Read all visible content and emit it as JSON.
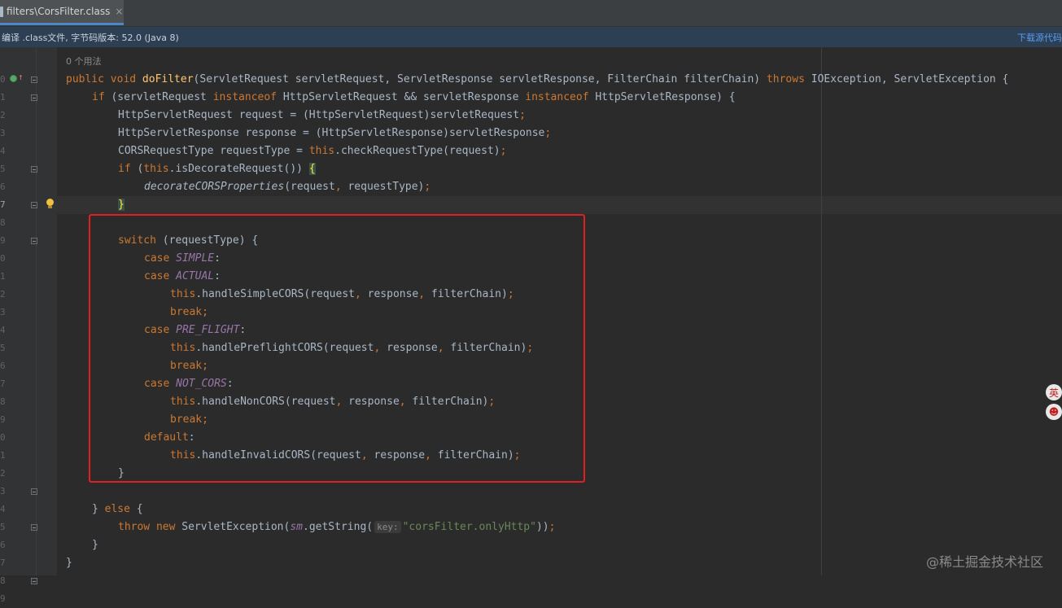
{
  "tab": {
    "label": "filters\\CorsFilter.class",
    "close": "×"
  },
  "infobar": {
    "text": "编译 .class文件, 字节码版本: 52.0 (Java 8)",
    "download_label": "下载源代码"
  },
  "gutter_numbers": [
    "",
    "0",
    "1",
    "2",
    "3",
    "4",
    "5",
    "6",
    "7",
    "8",
    "9",
    "0",
    "1",
    "2",
    "3",
    "4",
    "5",
    "6",
    "7",
    "8",
    "9",
    "0",
    "1",
    "2",
    "3",
    "4",
    "5",
    "6",
    "7",
    "8",
    "9"
  ],
  "code": {
    "usage_hint": "0 个用法",
    "l_sig": {
      "mods": "public void ",
      "name": "doFilter",
      "params": "(ServletRequest servletRequest, ServletResponse servletResponse, FilterChain filterChain) ",
      "throws": "throws",
      "rest": " IOException, ServletException {"
    },
    "l_if": {
      "kw1": "if",
      "t1": " (servletRequest ",
      "kw2": "instanceof",
      "t2": " HttpServletRequest && servletResponse ",
      "kw3": "instanceof",
      "t3": " HttpServletResponse) {"
    },
    "l_req": {
      "t1": "HttpServletRequest request = (HttpServletRequest)servletRequest",
      "semi": ";"
    },
    "l_resp": {
      "t1": "HttpServletResponse response = (HttpServletResponse)servletResponse",
      "semi": ";"
    },
    "l_type": {
      "t1": "CORSRequestType requestType = ",
      "kw": "this",
      "t2": ".checkRequestType(request)",
      "semi": ";"
    },
    "l_ifdec": {
      "kw1": "if",
      "t1": " (",
      "kw2": "this",
      "t2": ".isDecorateRequest()) ",
      "brace": "{"
    },
    "l_decor": {
      "call": "decorateCORSProperties",
      "t1": "(request",
      "comma": ",",
      "t2": " requestType)",
      "semi": ";"
    },
    "l_close1": {
      "brace": "}"
    },
    "l_switch": {
      "kw": "switch",
      "t1": " (requestType) {"
    },
    "l_case1": {
      "kw": "case ",
      "val": "SIMPLE",
      "colon": ":"
    },
    "l_case2": {
      "kw": "case ",
      "val": "ACTUAL",
      "colon": ":"
    },
    "l_simple": {
      "kw": "this",
      "t1": ".handleSimpleCORS(request",
      "c1": ",",
      "t2": " response",
      "c2": ",",
      "t3": " filterChain)",
      "semi": ";"
    },
    "l_break1": {
      "kw": "break",
      "semi": ";"
    },
    "l_case3": {
      "kw": "case ",
      "val": "PRE_FLIGHT",
      "colon": ":"
    },
    "l_preflight": {
      "kw": "this",
      "t1": ".handlePreflightCORS(request",
      "c1": ",",
      "t2": " response",
      "c2": ",",
      "t3": " filterChain)",
      "semi": ";"
    },
    "l_break2": {
      "kw": "break",
      "semi": ";"
    },
    "l_case4": {
      "kw": "case ",
      "val": "NOT_CORS",
      "colon": ":"
    },
    "l_noncors": {
      "kw": "this",
      "t1": ".handleNonCORS(request",
      "c1": ",",
      "t2": " response",
      "c2": ",",
      "t3": " filterChain)",
      "semi": ";"
    },
    "l_break3": {
      "kw": "break",
      "semi": ";"
    },
    "l_default": {
      "kw": "default",
      "colon": ":"
    },
    "l_invalid": {
      "kw": "this",
      "t1": ".handleInvalidCORS(request",
      "c1": ",",
      "t2": " response",
      "c2": ",",
      "t3": " filterChain)",
      "semi": ";"
    },
    "l_close2": {
      "brace": "}"
    },
    "l_else": {
      "t1": "} ",
      "kw": "else",
      "t2": " {"
    },
    "l_throw": {
      "kw1": "throw",
      "sp": " ",
      "kw2": "new",
      "t1": " ServletException(",
      "fld": "sm",
      "t2": ".getString(",
      "hint": "key:",
      "str": "\"corsFilter.onlyHttp\"",
      "t3": "))",
      "semi": ";"
    },
    "l_close3": {
      "brace": "}"
    },
    "l_close4": {
      "brace": "}"
    }
  },
  "side_widgets": {
    "lang": "英",
    "mascot": "☻"
  },
  "watermark": "@稀土掘金技术社区",
  "colors": {
    "keyword": "#cc7832",
    "function": "#ffc66d",
    "string": "#6a8759",
    "enum": "#9876aa",
    "text": "#a9b7c6",
    "highlight_box": "#e02020"
  }
}
